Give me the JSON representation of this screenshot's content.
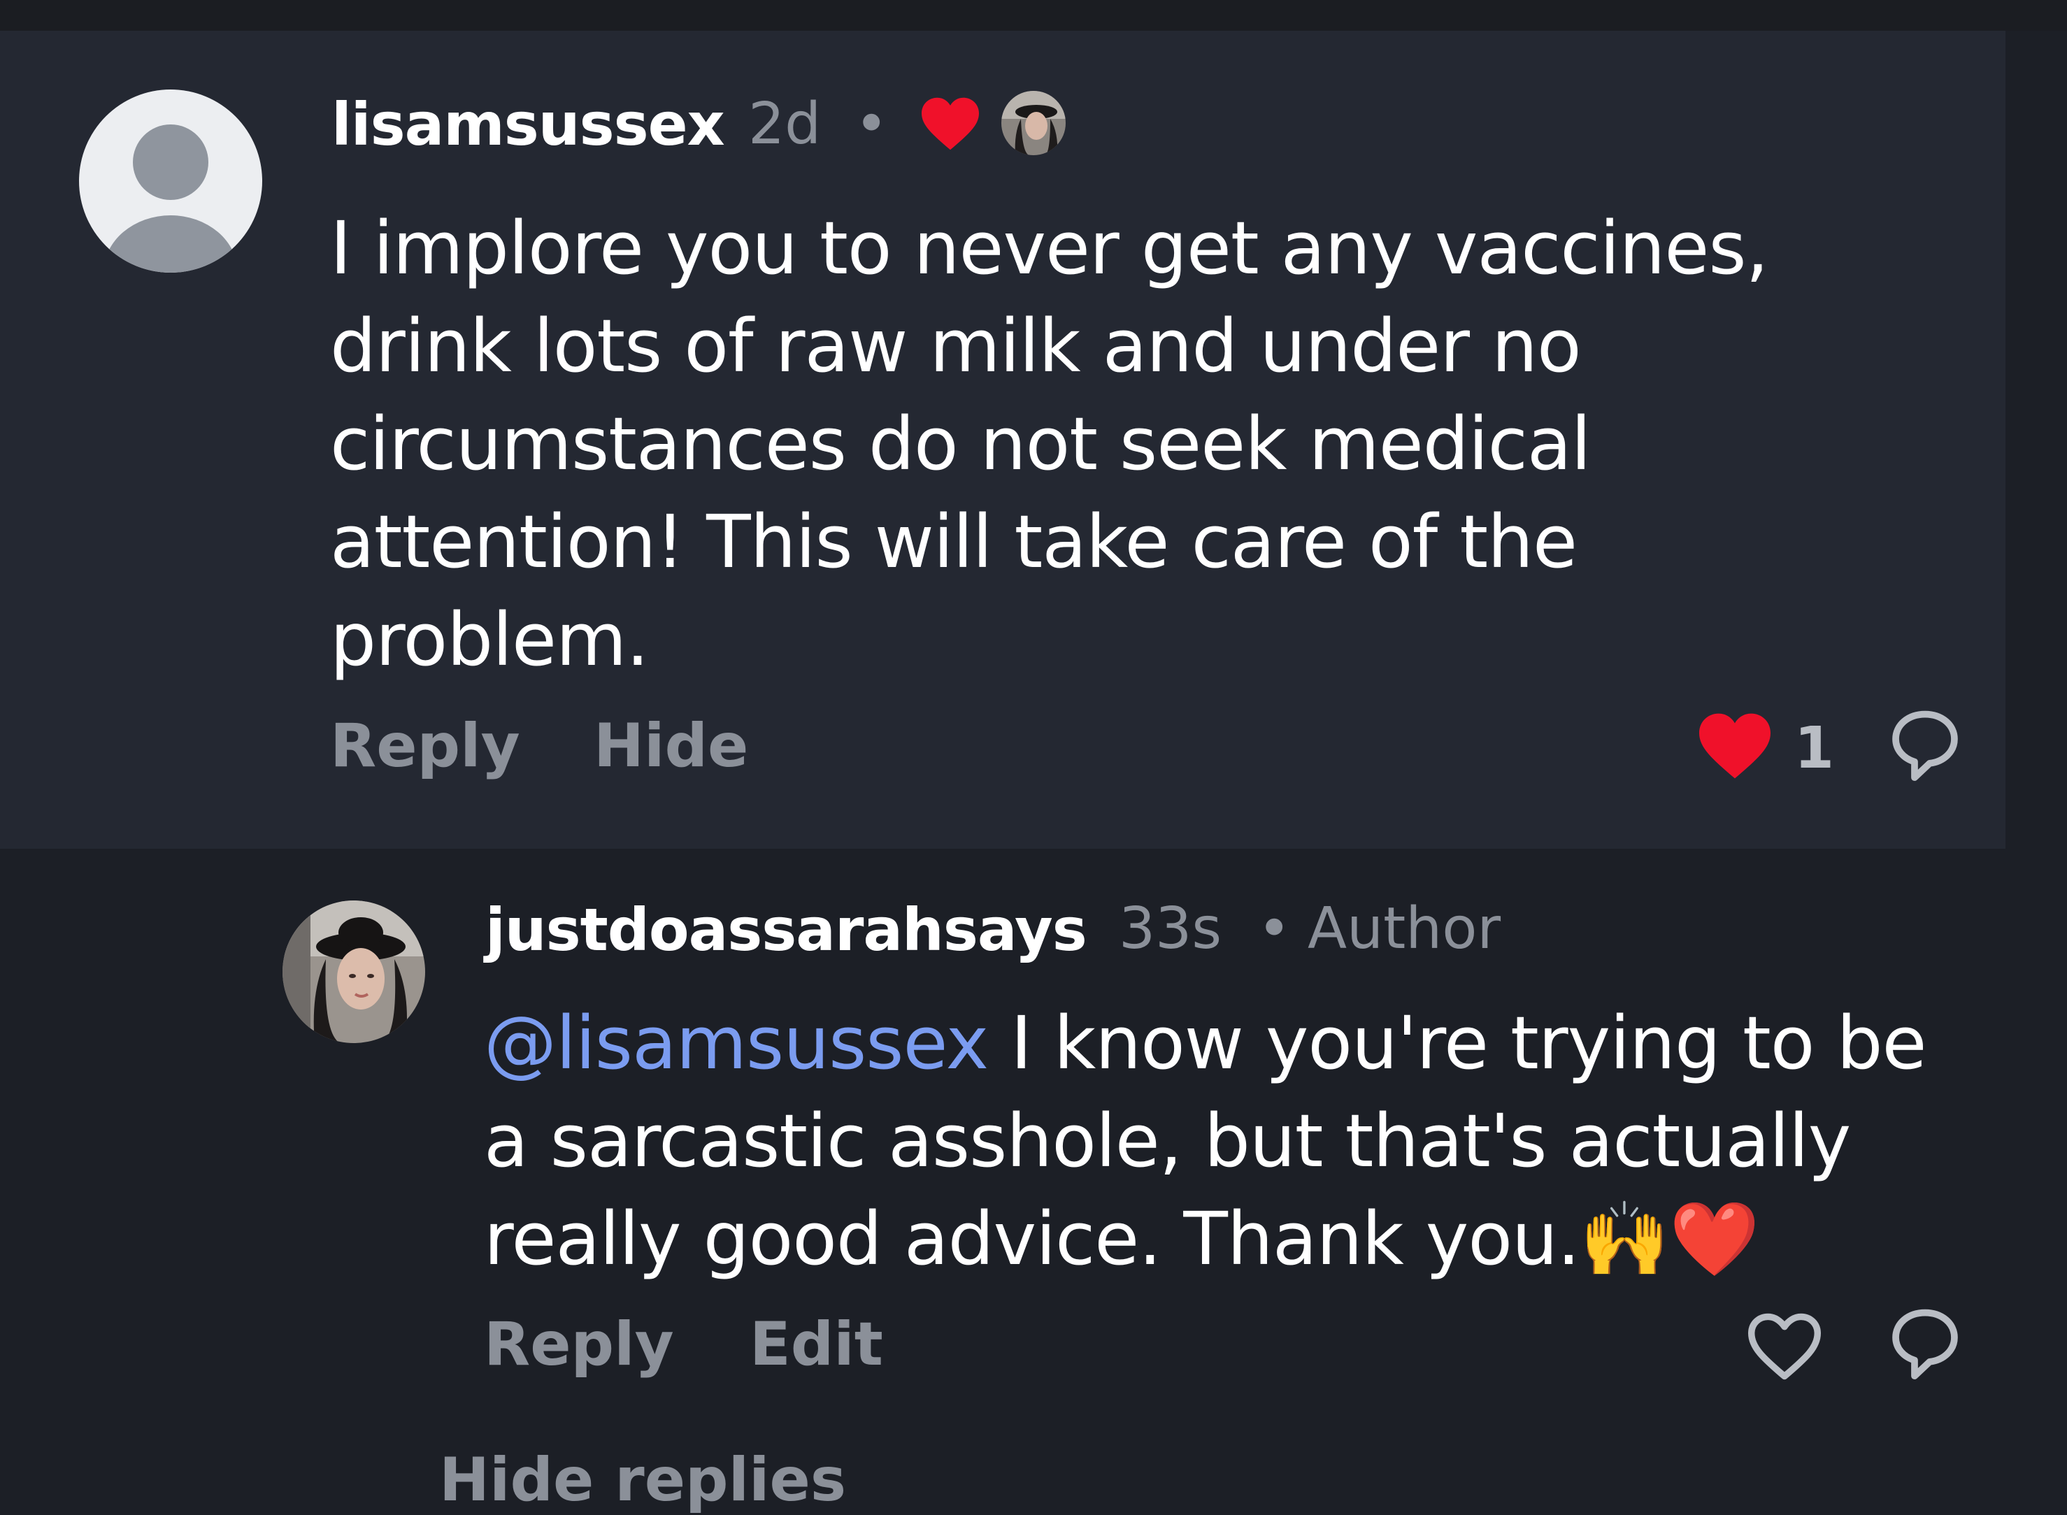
{
  "comment": {
    "username": "lisamsussex",
    "time": "2d",
    "separator": "•",
    "body_lines": [
      "I implore you to never get any vaccines,",
      "drink lots of raw milk and under no",
      "circumstances do not seek medical",
      "attention!  This will take care of the",
      "problem."
    ],
    "reply_label": "Reply",
    "hide_label": "Hide",
    "like_count": "1",
    "liked": true
  },
  "reply": {
    "username": "justdoassarahsays",
    "time": "33s",
    "separator": "•",
    "author_badge": "Author",
    "mention": "@lisamsussex",
    "body_lines": [
      " I know you're trying to be",
      "a sarcastic asshole, but that's actually",
      "really good advice. Thank you.🙌❤️"
    ],
    "reply_label": "Reply",
    "edit_label": "Edit",
    "liked": false
  },
  "footer": {
    "hide_replies_label": "Hide replies"
  },
  "colors": {
    "background": "#1c1f26",
    "card": "#242832",
    "text": "#ffffff",
    "muted": "#8b9099",
    "mention": "#7b9cf0",
    "heart": "#f0112a"
  },
  "icons": [
    "default-avatar-icon",
    "heart-icon",
    "comment-bubble-icon",
    "heart-outline-icon"
  ]
}
